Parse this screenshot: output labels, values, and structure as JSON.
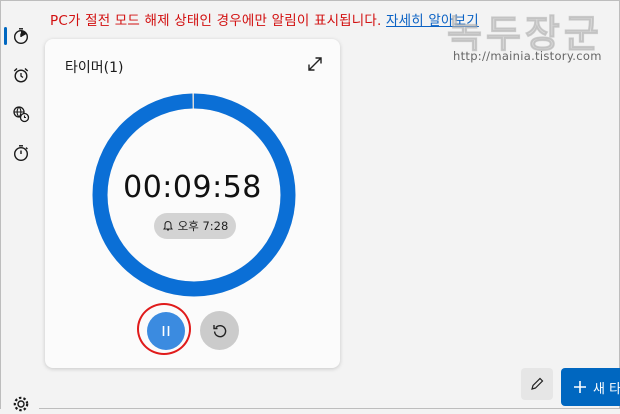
{
  "notice": {
    "text": "PC가 절전 모드 해제 상태인 경우에만 알림이 표시됩니다.",
    "link": "자세히 알아보기"
  },
  "watermark": {
    "text": "녹두장군",
    "url": "http://mainia.tistory.com"
  },
  "sidebar": {
    "items": [
      {
        "icon": "timer-icon",
        "active": true
      },
      {
        "icon": "alarm-clock-icon"
      },
      {
        "icon": "world-clock-icon"
      },
      {
        "icon": "stopwatch-icon"
      },
      {
        "icon": "settings-gear-icon"
      }
    ]
  },
  "timer_card": {
    "title": "타이머(1)",
    "time": "00:09:58",
    "alarm_time": "오후 7:28",
    "progress_fraction": 0.997
  },
  "actions": {
    "new_label": "새 타"
  },
  "colors": {
    "accent": "#0067c0",
    "ring": "#0b6fd6",
    "highlight": "#e01b1b",
    "notice": "#d20f0f"
  }
}
